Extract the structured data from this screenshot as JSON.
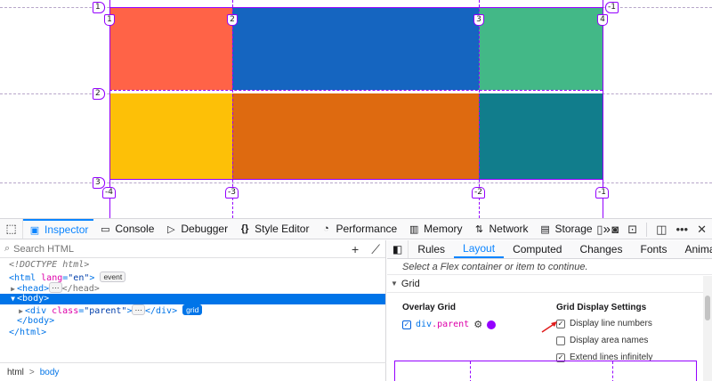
{
  "overlay": {
    "colors": {
      "cell_1": "#ff6347",
      "cell_2": "#1565c0",
      "cell_3": "#43b887",
      "cell_4": "#fdc007",
      "cell_5": "#de6a10",
      "cell_6": "#117d8c",
      "grid_line": "#9400ff"
    },
    "col_numbers_top": [
      "1",
      "2",
      "3",
      "4"
    ],
    "col_numbers_bottom": [
      "-4",
      "-3",
      "-2",
      "-1"
    ],
    "row_numbers_left": [
      "1",
      "2",
      "3"
    ],
    "row_numbers_right": [
      "-1"
    ]
  },
  "toolbox": {
    "tabs": [
      {
        "label": "Inspector",
        "icon": "inspector-icon"
      },
      {
        "label": "Console",
        "icon": "console-icon"
      },
      {
        "label": "Debugger",
        "icon": "debugger-icon"
      },
      {
        "label": "Style Editor",
        "icon": "braces-icon"
      },
      {
        "label": "Performance",
        "icon": "gauge-icon"
      },
      {
        "label": "Memory",
        "icon": "memory-icon"
      },
      {
        "label": "Network",
        "icon": "network-arrows-icon"
      },
      {
        "label": "Storage",
        "icon": "storage-icon"
      }
    ],
    "more_tabs": "»",
    "active_tab": "Inspector"
  },
  "markup": {
    "search_placeholder": "Search HTML",
    "lines": {
      "doctype": "<!DOCTYPE html>",
      "html_open_tag": "html",
      "html_attr": "lang",
      "html_val": "\"en\"",
      "event_badge": "event",
      "head_tag": "head",
      "body_tag": "body",
      "div_tag": "div",
      "div_attr": "class",
      "div_val": "\"parent\"",
      "grid_badge": "grid",
      "ellipsis": "⋯"
    },
    "breadcrumbs": [
      "html",
      "body"
    ]
  },
  "sidebar": {
    "tabs": [
      "Rules",
      "Layout",
      "Computed",
      "Changes",
      "Fonts",
      "Animations"
    ],
    "active_tab": "Layout",
    "hint": "Select a Flex container or item to continue.",
    "grid_section": "Grid",
    "overlay_grid_title": "Overlay Grid",
    "overlay_item_tag": "div",
    "overlay_item_class": ".parent",
    "overlay_swatch_color": "#9400ff",
    "settings_title": "Grid Display Settings",
    "settings": [
      {
        "label": "Display line numbers",
        "checked": true
      },
      {
        "label": "Display area names",
        "checked": false
      },
      {
        "label": "Extend lines infinitely",
        "checked": true
      }
    ]
  }
}
